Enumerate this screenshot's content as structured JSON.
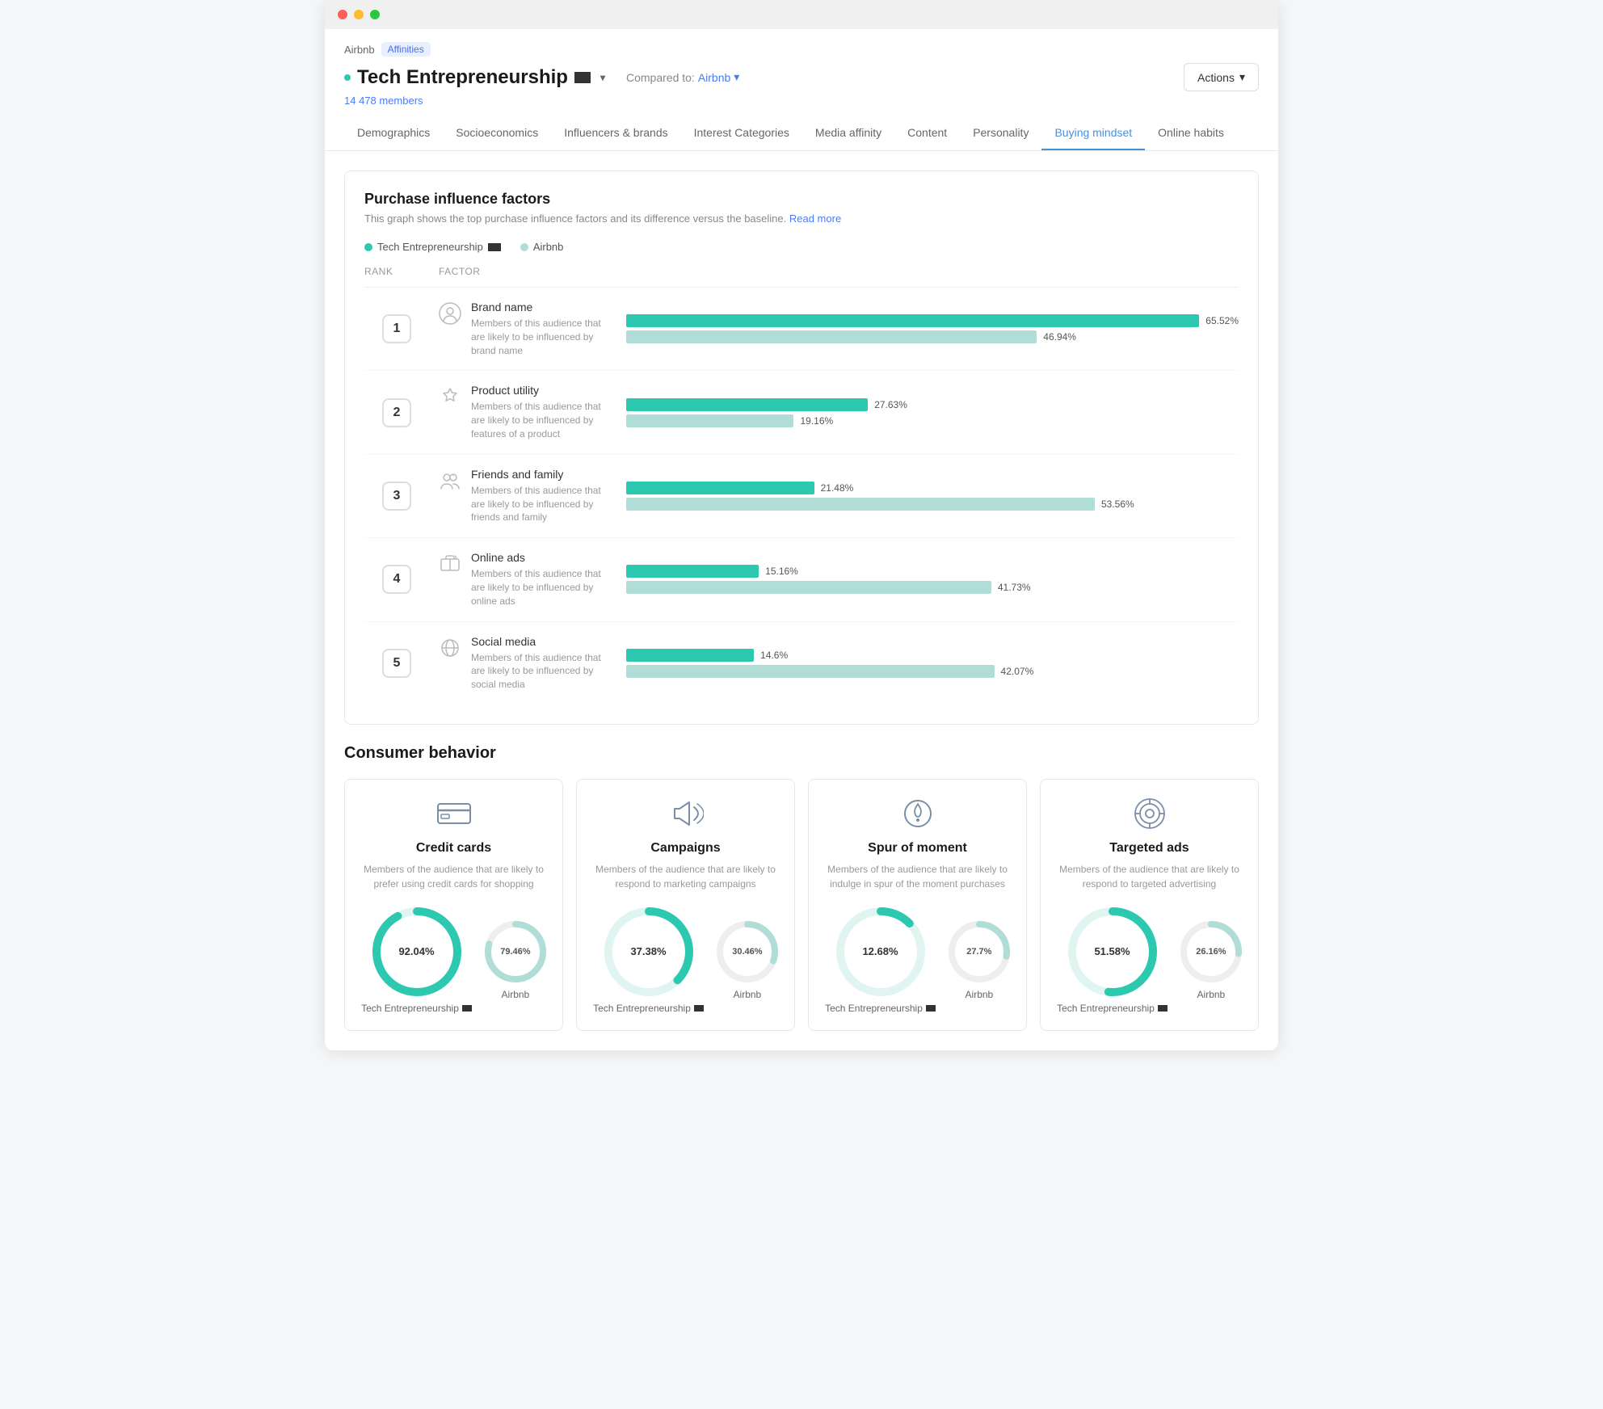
{
  "window": {
    "title": "Tech Entrepreneurship - Affinities"
  },
  "breadcrumb": {
    "parent": "Airbnb",
    "badge": "Affinities"
  },
  "header": {
    "title": "Tech Entrepreneurship",
    "compared_to_label": "Compared to:",
    "compared_to_value": "Airbnb",
    "members_count": "14 478 members",
    "actions_label": "Actions"
  },
  "nav": {
    "tabs": [
      {
        "id": "demographics",
        "label": "Demographics",
        "active": false
      },
      {
        "id": "socioeconomics",
        "label": "Socioeconomics",
        "active": false
      },
      {
        "id": "influencers",
        "label": "Influencers & brands",
        "active": false
      },
      {
        "id": "interest",
        "label": "Interest Categories",
        "active": false
      },
      {
        "id": "media",
        "label": "Media affinity",
        "active": false
      },
      {
        "id": "content",
        "label": "Content",
        "active": false
      },
      {
        "id": "personality",
        "label": "Personality",
        "active": false
      },
      {
        "id": "buying",
        "label": "Buying mindset",
        "active": true
      },
      {
        "id": "online",
        "label": "Online habits",
        "active": false
      }
    ]
  },
  "purchase_section": {
    "title": "Purchase influence factors",
    "description": "This graph shows the top purchase influence factors and its difference versus the baseline.",
    "read_more": "Read more",
    "legend": {
      "tech_label": "Tech Entrepreneurship",
      "airbnb_label": "Airbnb"
    },
    "table_headers": [
      "Rank",
      "Factor",
      ""
    ],
    "factors": [
      {
        "rank": "1",
        "name": "Brand name",
        "description": "Members of this audience that are likely to be influenced by brand name",
        "icon": "🏷",
        "tech_pct": 65.52,
        "airbnb_pct": 46.94,
        "tech_label": "65.52%",
        "airbnb_label": "46.94%",
        "max": 70
      },
      {
        "rank": "2",
        "name": "Product utility",
        "description": "Members of this audience that are likely to be influenced by features of a product",
        "icon": "💎",
        "tech_pct": 27.63,
        "airbnb_pct": 19.16,
        "tech_label": "27.63%",
        "airbnb_label": "19.16%",
        "max": 70
      },
      {
        "rank": "3",
        "name": "Friends and family",
        "description": "Members of this audience that are likely to be influenced by friends and family",
        "icon": "👥",
        "tech_pct": 21.48,
        "airbnb_pct": 53.56,
        "tech_label": "21.48%",
        "airbnb_label": "53.56%",
        "max": 70
      },
      {
        "rank": "4",
        "name": "Online ads",
        "description": "Members of this audience that are likely to be influenced by online ads",
        "icon": "🖥",
        "tech_pct": 15.16,
        "airbnb_pct": 41.73,
        "tech_label": "15.16%",
        "airbnb_label": "41.73%",
        "max": 70
      },
      {
        "rank": "5",
        "name": "Social media",
        "description": "Members of this audience that are likely to be influenced by social media",
        "icon": "🌐",
        "tech_pct": 14.6,
        "airbnb_pct": 42.07,
        "tech_label": "14.6%",
        "airbnb_label": "42.07%",
        "max": 70
      }
    ]
  },
  "consumer_section": {
    "title": "Consumer behavior",
    "cards": [
      {
        "id": "credit-cards",
        "title": "Credit cards",
        "description": "Members of the audience that are likely to prefer using credit cards for shopping",
        "icon": "💳",
        "tech_pct": 92.04,
        "airbnb_pct": 79.46,
        "tech_label": "92.04%",
        "airbnb_label": "79.46%"
      },
      {
        "id": "campaigns",
        "title": "Campaigns",
        "description": "Members of the audience that are likely to respond to marketing campaigns",
        "icon": "📢",
        "tech_pct": 37.38,
        "airbnb_pct": 30.46,
        "tech_label": "37.38%",
        "airbnb_label": "30.46%"
      },
      {
        "id": "spur-of-moment",
        "title": "Spur of moment",
        "description": "Members of the audience that are likely to indulge in spur of the moment purchases",
        "icon": "🔥",
        "tech_pct": 12.68,
        "airbnb_pct": 27.7,
        "tech_label": "12.68%",
        "airbnb_label": "27.7%"
      },
      {
        "id": "targeted-ads",
        "title": "Targeted ads",
        "description": "Members of the audience that are likely to respond to targeted advertising",
        "icon": "🎯",
        "tech_pct": 51.58,
        "airbnb_pct": 26.16,
        "tech_label": "51.58%",
        "airbnb_label": "26.16%"
      }
    ],
    "tech_label": "Tech Entrepreneurship",
    "airbnb_label": "Airbnb"
  },
  "colors": {
    "teal": "#2dc8b0",
    "light_teal": "#b0ddd8",
    "blue": "#4a90d9",
    "dark": "#333333",
    "light_gray": "#e8e8e8"
  }
}
